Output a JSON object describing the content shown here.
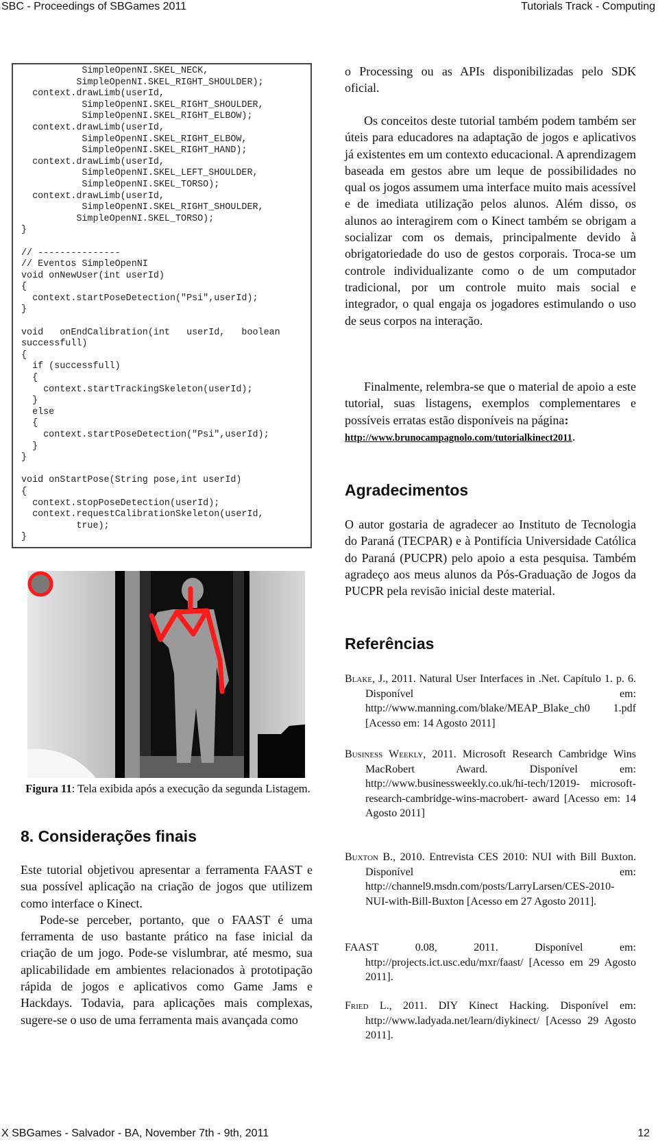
{
  "header": {
    "left": "SBC - Proceedings of SBGames 2011",
    "right": "Tutorials Track - Computing"
  },
  "footer": {
    "left": "X SBGames - Salvador - BA, November 7th - 9th, 2011",
    "page_number": "12"
  },
  "code_listing": {
    "lines": [
      "           SimpleOpenNI.SKEL_NECK,",
      "          SimpleOpenNI.SKEL_RIGHT_SHOULDER);",
      "  context.drawLimb(userId,",
      "           SimpleOpenNI.SKEL_RIGHT_SHOULDER,",
      "           SimpleOpenNI.SKEL_RIGHT_ELBOW);",
      "  context.drawLimb(userId,",
      "           SimpleOpenNI.SKEL_RIGHT_ELBOW,",
      "           SimpleOpenNI.SKEL_RIGHT_HAND);",
      "  context.drawLimb(userId,",
      "           SimpleOpenNI.SKEL_LEFT_SHOULDER,",
      "           SimpleOpenNI.SKEL_TORSO);",
      "  context.drawLimb(userId,",
      "           SimpleOpenNI.SKEL_RIGHT_SHOULDER,",
      "          SimpleOpenNI.SKEL_TORSO);",
      "}",
      "",
      "// ---------------",
      "// Eventos SimpleOpenNI",
      "void onNewUser(int userId)",
      "{",
      "  context.startPoseDetection(\"Psi\",userId);",
      "}",
      "",
      "void   onEndCalibration(int   userId,   boolean",
      "successfull)",
      "{",
      "  if (successfull)",
      "  {",
      "    context.startTrackingSkeleton(userId);",
      "  }",
      "  else",
      "  {",
      "    context.startPoseDetection(\"Psi\",userId);",
      "  }",
      "}",
      "",
      "void onStartPose(String pose,int userId)",
      "{",
      "  context.stopPoseDetection(userId);",
      "  context.requestCalibrationSkeleton(userId,",
      "          true);",
      "}"
    ]
  },
  "figure": {
    "description": "Kinect depth image with tracked skeleton in red",
    "skeleton_color": "#ff1a1a",
    "caption_label": "Figura 11",
    "caption_text": ": Tela exibida após a execução da segunda Listagem."
  },
  "section8": {
    "title": "8. Considerações finais",
    "paragraph1": "Este tutorial objetivou apresentar a ferramenta FAAST e sua possível aplicação na criação de jogos que utilizem como interface o Kinect.",
    "paragraph2": "Pode-se perceber, portanto, que o FAAST é uma ferramenta de uso bastante prático na fase inicial da criação de um jogo. Pode-se vislumbrar, até mesmo, sua aplicabilidade em ambientes relacionados à prototipação rápida de jogos e aplicativos como Game Jams e Hackdays. Todavia, para aplicações mais complexas, sugere-se o uso de uma ferramenta mais avançada como"
  },
  "right_column": {
    "paragraph_cont": "o Processing ou as APIs disponibilizadas pelo SDK oficial.",
    "paragraph_edu": "Os conceitos deste tutorial também podem também ser úteis  para educadores na adaptação de jogos e aplicativos já existentes em um contexto educacional. A aprendizagem baseada em gestos abre um leque de possibilidades no qual os jogos assumem uma interface muito mais acessível e de imediata utilização pelos alunos. Além disso, os alunos ao interagirem com o Kinect também se obrigam a socializar com os demais, principalmente devido à obrigatoriedade do uso de gestos corporais. Troca-se um controle individualizante como o de um computador tradicional, por um controle muito mais social e integrador, o qual engaja os jogadores estimulando o uso de seus corpos na interação.",
    "paragraph_final": "Finalmente, relembra-se que o material de apoio a este tutorial, suas listagens, exemplos complementares e possíveis erratas estão disponíveis na página",
    "colon": ":",
    "link": "http://www.brunocampagnolo.com/tutorialkinect2011",
    "link_suffix": "."
  },
  "acknowledgements": {
    "title": "Agradecimentos",
    "text": "O autor gostaria de agradecer ao Instituto de Tecnologia do Paraná (TECPAR) e à Pontifícia Universidade Católica do Paraná (PUCPR) pelo apoio a esta pesquisa. Também agradeço aos meus alunos da Pós-Graduação de Jogos da PUCPR pela revisão inicial deste material."
  },
  "references": {
    "title": "Referências",
    "items": [
      {
        "author": "Blake",
        "rest": ", J., 2011. Natural User Interfaces in .Net. Capítulo 1. p. 6. Disponível em: http://www.manning.com/blake/MEAP_Blake_ch0 1.pdf [Acesso em: 14 Agosto 2011]"
      },
      {
        "author": "Business Weekly",
        "rest": ", 2011. Microsoft Research Cambridge Wins MacRobert Award. Disponível em: http://www.businessweekly.co.uk/hi-tech/12019- microsoft-research-cambridge-wins-macrobert- award [Acesso em: 14 Agosto 2011]"
      },
      {
        "author": "Buxton",
        "rest": " B., 2010. Entrevista CES 2010: NUI with Bill Buxton. Disponível em: http://channel9.msdn.com/posts/LarryLarsen/CES-2010-NUI-with-Bill-Buxton [Acesso em 27 Agosto 2011]."
      },
      {
        "author": "FAAST",
        "rest": " 0.08, 2011. Disponível em: http://projects.ict.usc.edu/mxr/faast/ [Acesso em 29 Agosto 2011]."
      },
      {
        "author": "Fried",
        "rest": " L., 2011. DIY Kinect Hacking. Disponível em: http://www.ladyada.net/learn/diykinect/ [Acesso 29 Agosto 2011]."
      }
    ]
  }
}
